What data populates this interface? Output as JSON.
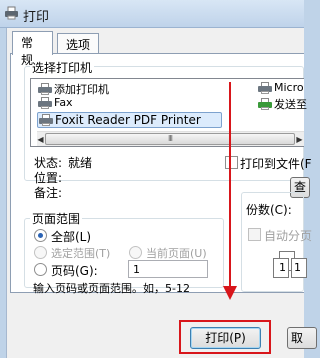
{
  "window": {
    "title": "打印"
  },
  "tabs": [
    "常规",
    "选项"
  ],
  "select_printer": {
    "legend": "选择打印机",
    "printers_left": [
      "添加打印机",
      "Fax",
      "Foxit Reader PDF Printer"
    ],
    "printers_right": [
      "Micro",
      "发送至"
    ],
    "scroll_thumb": "III"
  },
  "status": {
    "status_label": "状态:",
    "status_value": "就绪",
    "location_label": "位置:",
    "comment_label": "备注:",
    "print_to_file_label": "打印到文件(F",
    "find_button_label": "查"
  },
  "page_range": {
    "legend": "页面范围",
    "all_label": "全部(L)",
    "selection_label": "选定范围(T)",
    "current_page_label": "当前页面(U)",
    "pages_label": "页码(G):",
    "pages_value": "1",
    "hint": "输入页码或页面范围。如，5-12"
  },
  "copies": {
    "copies_label": "份数(C):",
    "collate_label": "自动分页",
    "collate_page_1": "1",
    "collate_page_2": "1"
  },
  "buttons": {
    "print_label": "打印(P)",
    "cancel_label": "取"
  },
  "colors": {
    "annotation_red": "#d8161b",
    "selection_blue": "#dcebfc"
  }
}
